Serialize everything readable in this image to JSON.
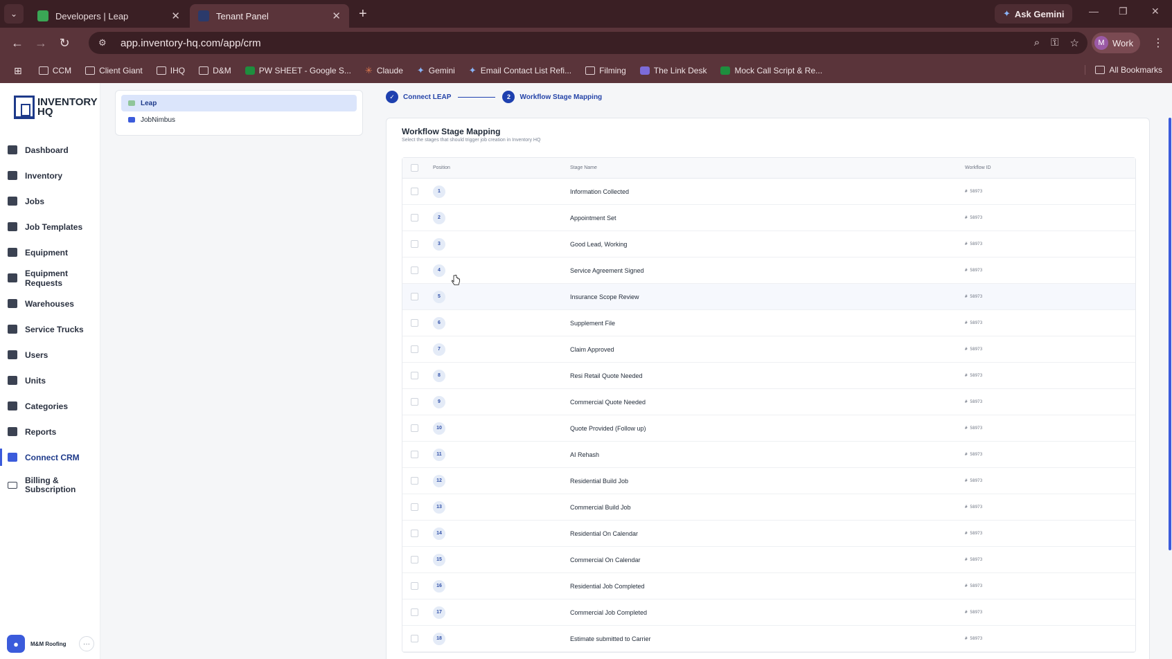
{
  "browser": {
    "tabs": [
      {
        "title": "Developers | Leap",
        "active": false
      },
      {
        "title": "Tenant Panel",
        "active": true
      }
    ],
    "ask_gemini": "Ask Gemini",
    "url": "app.inventory-hq.com/app/crm",
    "profile": {
      "initial": "M",
      "label": "Work"
    },
    "bookmarks": [
      {
        "label": "CCM",
        "icon": "folder-icon"
      },
      {
        "label": "Client Giant",
        "icon": "folder-icon"
      },
      {
        "label": "IHQ",
        "icon": "folder-icon"
      },
      {
        "label": "D&M",
        "icon": "folder-icon"
      },
      {
        "label": "PW SHEET - Google S...",
        "icon": "sheets-icon"
      },
      {
        "label": "Claude",
        "icon": "claude-icon"
      },
      {
        "label": "Gemini",
        "icon": "gemini-icon"
      },
      {
        "label": "Email Contact List Refi...",
        "icon": "gemini-icon"
      },
      {
        "label": "Filming",
        "icon": "folder-icon"
      },
      {
        "label": "The Link Desk",
        "icon": "site-icon"
      },
      {
        "label": "Mock Call Script & Re...",
        "icon": "sheets-icon"
      }
    ],
    "all_bookmarks": "All Bookmarks"
  },
  "app": {
    "logo_line1": "INVENTORY",
    "logo_line2": "HQ",
    "menu": [
      {
        "label": "Dashboard",
        "icon": "dashboard-icon",
        "active": false
      },
      {
        "label": "Inventory",
        "icon": "inventory-icon",
        "active": false
      },
      {
        "label": "Jobs",
        "icon": "jobs-icon",
        "active": false
      },
      {
        "label": "Job Templates",
        "icon": "job-templates-icon",
        "active": false
      },
      {
        "label": "Equipment",
        "icon": "equipment-icon",
        "active": false
      },
      {
        "label": "Equipment Requests",
        "icon": "equipment-requests-icon",
        "active": false
      },
      {
        "label": "Warehouses",
        "icon": "warehouses-icon",
        "active": false
      },
      {
        "label": "Service Trucks",
        "icon": "truck-icon",
        "active": false
      },
      {
        "label": "Users",
        "icon": "users-icon",
        "active": false
      },
      {
        "label": "Units",
        "icon": "units-icon",
        "active": false
      },
      {
        "label": "Categories",
        "icon": "categories-icon",
        "active": false
      },
      {
        "label": "Reports",
        "icon": "reports-icon",
        "active": false
      },
      {
        "label": "Connect CRM",
        "icon": "connect-crm-icon",
        "active": true
      },
      {
        "label": "Billing & Subscription",
        "icon": "billing-icon",
        "active": false
      }
    ],
    "user": {
      "name": "M&M Roofing",
      "more": "···"
    }
  },
  "crm_list": [
    {
      "label": "Leap",
      "selected": true
    },
    {
      "label": "JobNimbus",
      "selected": false
    }
  ],
  "stepper": [
    {
      "label": "Connect LEAP",
      "marker": "✓"
    },
    {
      "label": "Workflow Stage Mapping",
      "marker": "2"
    }
  ],
  "card": {
    "title": "Workflow Stage Mapping",
    "subtitle": "Select the stages that should trigger job creation in Inventory HQ",
    "columns": {
      "position": "Position",
      "stage": "Stage Name",
      "workflow": "Workflow ID"
    },
    "rows": [
      {
        "position": "1",
        "stage": "Information Collected",
        "workflow": "# 58973"
      },
      {
        "position": "2",
        "stage": "Appointment Set",
        "workflow": "# 58973"
      },
      {
        "position": "3",
        "stage": "Good Lead, Working",
        "workflow": "# 58973"
      },
      {
        "position": "4",
        "stage": "Service Agreement Signed",
        "workflow": "# 58973"
      },
      {
        "position": "5",
        "stage": "Insurance Scope Review",
        "workflow": "# 58973"
      },
      {
        "position": "6",
        "stage": "Supplement File",
        "workflow": "# 58973"
      },
      {
        "position": "7",
        "stage": "Claim Approved",
        "workflow": "# 58973"
      },
      {
        "position": "8",
        "stage": "Resi Retail Quote Needed",
        "workflow": "# 58973"
      },
      {
        "position": "9",
        "stage": "Commercial Quote Needed",
        "workflow": "# 58973"
      },
      {
        "position": "10",
        "stage": "Quote Provided (Follow up)",
        "workflow": "# 58973"
      },
      {
        "position": "11",
        "stage": "AI Rehash",
        "workflow": "# 58973"
      },
      {
        "position": "12",
        "stage": "Residential Build Job",
        "workflow": "# 58973"
      },
      {
        "position": "13",
        "stage": "Commercial Build Job",
        "workflow": "# 58973"
      },
      {
        "position": "14",
        "stage": "Residential On Calendar",
        "workflow": "# 58973"
      },
      {
        "position": "15",
        "stage": "Commercial On Calendar",
        "workflow": "# 58973"
      },
      {
        "position": "16",
        "stage": "Residential Job Completed",
        "workflow": "# 58973"
      },
      {
        "position": "17",
        "stage": "Commercial Job Completed",
        "workflow": "# 58973"
      },
      {
        "position": "18",
        "stage": "Estimate submitted to Carrier",
        "workflow": "# 58973"
      }
    ]
  }
}
